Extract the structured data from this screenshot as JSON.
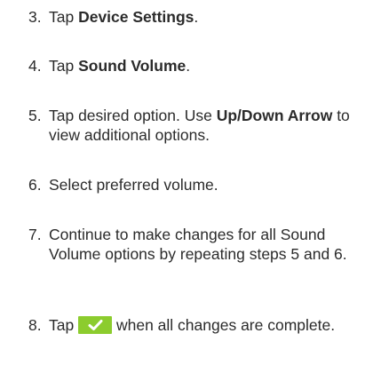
{
  "steps": [
    {
      "num": "3.",
      "parts": [
        "Tap ",
        "Device Settings",
        "."
      ]
    },
    {
      "num": "4.",
      "parts": [
        "Tap ",
        "Sound Volume",
        "."
      ]
    },
    {
      "num": "5.",
      "parts": [
        "Tap desired option. Use ",
        "Up/Down Arrow",
        " to view additional options."
      ]
    },
    {
      "num": "6.",
      "text": "Select preferred volume."
    },
    {
      "num": "7.",
      "text": "Continue to make changes for all Sound Volume options by repeating steps 5 and 6."
    },
    {
      "num": "8.",
      "before": "Tap",
      "icon": "checkmark-confirm-icon",
      "after": "when all changes are complete."
    }
  ],
  "colors": {
    "text": "#2b2b2b",
    "check_bg": "#8ccc2e",
    "check_mark": "#ffffff"
  }
}
